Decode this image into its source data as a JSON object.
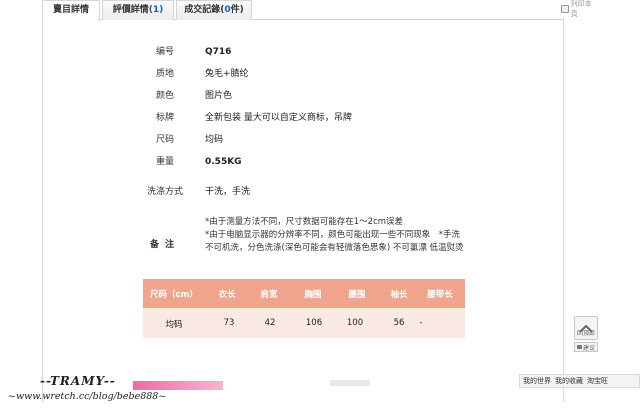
{
  "tabs": [
    {
      "label": "賣目詳情"
    },
    {
      "label": "評價詳情",
      "count": "(1)"
    },
    {
      "label": "成交記錄",
      "count_prefix": "(",
      "count_num": "0",
      "count_suffix": "件)"
    }
  ],
  "print_label": "列印本頁",
  "specs": [
    {
      "label": "编号",
      "value": "Q716",
      "bold": true
    },
    {
      "label": "质地",
      "value": "兔毛+腈纶",
      "bold": false
    },
    {
      "label": "颜色",
      "value": "图片色",
      "bold": false
    },
    {
      "label": "标牌",
      "value": "全新包装 量大可以自定义商标，吊牌",
      "bold": false
    },
    {
      "label": "尺码",
      "value": "均码",
      "bold": false
    },
    {
      "label": "重量",
      "value": "0.55KG",
      "bold": true
    },
    {
      "label": "洗涤方式",
      "value": "干洗，手洗",
      "bold": false
    }
  ],
  "notes": {
    "label": "备注",
    "line1": "*由于测量方法不同，尺寸数据可能存在1～2cm误差",
    "line2": "*由于电脑显示器的分辨率不同，颜色可能出现一些不同现象　*手洗不可机洗，分色洗涤(深色可能会有轻微落色思象) 不可氯漂 低温熨烫"
  },
  "size_table": {
    "headers": [
      "尺码（cm）",
      "衣长",
      "肩宽",
      "胸围",
      "腰围",
      "袖长",
      "腰带长"
    ],
    "row": [
      "均码",
      "73",
      "42",
      "106",
      "100",
      "56",
      "-"
    ]
  },
  "widgets": {
    "back_top": "回頂部",
    "suggest": "建议"
  },
  "bottom_bar": {
    "item1": "我的世界",
    "item2": "我的收藏",
    "item3": "淘宝旺"
  },
  "watermark": {
    "name": "--TRAMY--",
    "url": "~www.wretch.cc/blog/bebe888~"
  }
}
